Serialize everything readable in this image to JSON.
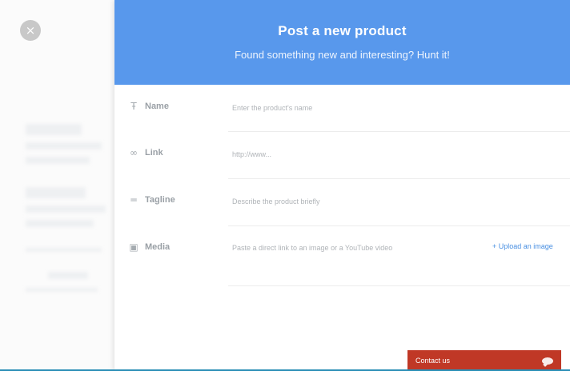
{
  "modal": {
    "title": "Post a new product",
    "subtitle": "Found something new and interesting? Hunt it!"
  },
  "close": {
    "glyph": "×",
    "icon": "close-icon"
  },
  "form": {
    "name": {
      "label": "Name",
      "icon": "text-icon",
      "placeholder": "Enter the product's name"
    },
    "link": {
      "label": "Link",
      "icon": "link-icon",
      "placeholder": "http://www..."
    },
    "tagline": {
      "label": "Tagline",
      "icon": "tagline-icon",
      "placeholder": "Describe the product briefly"
    },
    "media": {
      "label": "Media",
      "icon": "image-icon",
      "placeholder": "Paste a direct link to an image or a YouTube video",
      "upload_label": "+ Upload an image"
    }
  },
  "contact": {
    "label": "Contact us",
    "icon": "chat-icon"
  },
  "colors": {
    "header": "#5898ec",
    "contact_bar": "#c03826",
    "link": "#4a90e2"
  }
}
